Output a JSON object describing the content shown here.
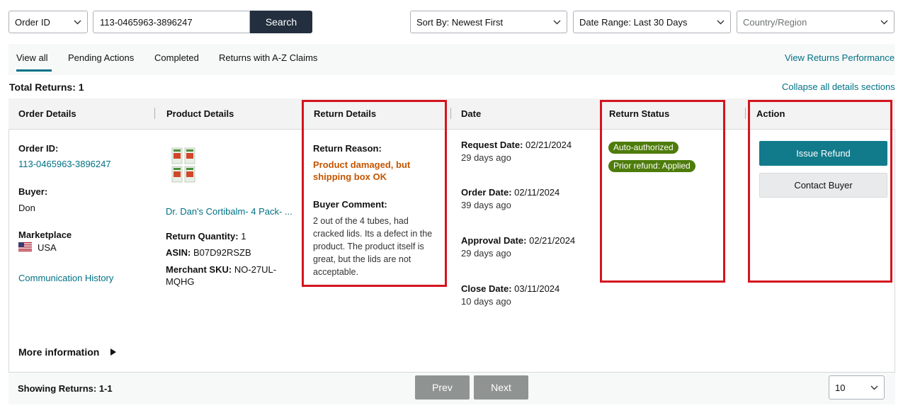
{
  "filters": {
    "search_type": "Order ID",
    "search_value": "113-0465963-3896247",
    "search_button": "Search",
    "sort": "Sort By: Newest First",
    "date_range": "Date Range: Last 30 Days",
    "country_placeholder": "Country/Region"
  },
  "tabs": {
    "items": [
      "View all",
      "Pending Actions",
      "Completed",
      "Returns with A-Z Claims"
    ],
    "active": "View all",
    "view_performance": "View Returns Performance"
  },
  "summary": {
    "total_returns": "Total Returns: 1",
    "collapse_link": "Collapse all details sections"
  },
  "columns": [
    "Order Details",
    "Product Details",
    "Return Details",
    "Date",
    "Return Status",
    "Action"
  ],
  "order": {
    "order_id_label": "Order ID:",
    "order_id": "113-0465963-3896247",
    "buyer_label": "Buyer:",
    "buyer": "Don",
    "marketplace_label": "Marketplace",
    "marketplace": "USA",
    "communication_history": "Communication History"
  },
  "product": {
    "title": "Dr. Dan's Cortibalm- 4 Pack- ...",
    "quantity_label": "Return Quantity:",
    "quantity": "1",
    "asin_label": "ASIN:",
    "asin": "B07D92RSZB",
    "sku_label": "Merchant SKU:",
    "sku_line1": "NO-27UL-",
    "sku_line2": "MQHG"
  },
  "return_details": {
    "reason_label": "Return Reason:",
    "reason_line1": "Product damaged, but",
    "reason_line2": "shipping box OK",
    "comment_label": "Buyer Comment:",
    "comment_lines": [
      "2 out of the 4 tubes, had",
      "cracked lids. Its a defect in the",
      "product. The product itself is",
      "great, but the lids are not",
      "acceptable."
    ]
  },
  "dates": [
    {
      "label": "Request Date:",
      "date": "02/21/2024",
      "ago": "29 days ago"
    },
    {
      "label": "Order Date:",
      "date": "02/11/2024",
      "ago": "39 days ago"
    },
    {
      "label": "Approval Date:",
      "date": "02/21/2024",
      "ago": "29 days ago"
    },
    {
      "label": "Close Date:",
      "date": "03/11/2024",
      "ago": "10 days ago"
    }
  ],
  "status_badges": [
    "Auto-authorized",
    "Prior refund: Applied"
  ],
  "actions": {
    "issue_refund": "Issue Refund",
    "contact_buyer": "Contact Buyer"
  },
  "more_information": "More information",
  "footer": {
    "showing": "Showing Returns: 1-1",
    "prev": "Prev",
    "next": "Next",
    "page_size": "10"
  },
  "colors": {
    "link": "#007185",
    "reason": "#c45500",
    "badge": "#4e7c0b",
    "primary_button": "#117a8b",
    "highlight_box": "#d5141f"
  }
}
